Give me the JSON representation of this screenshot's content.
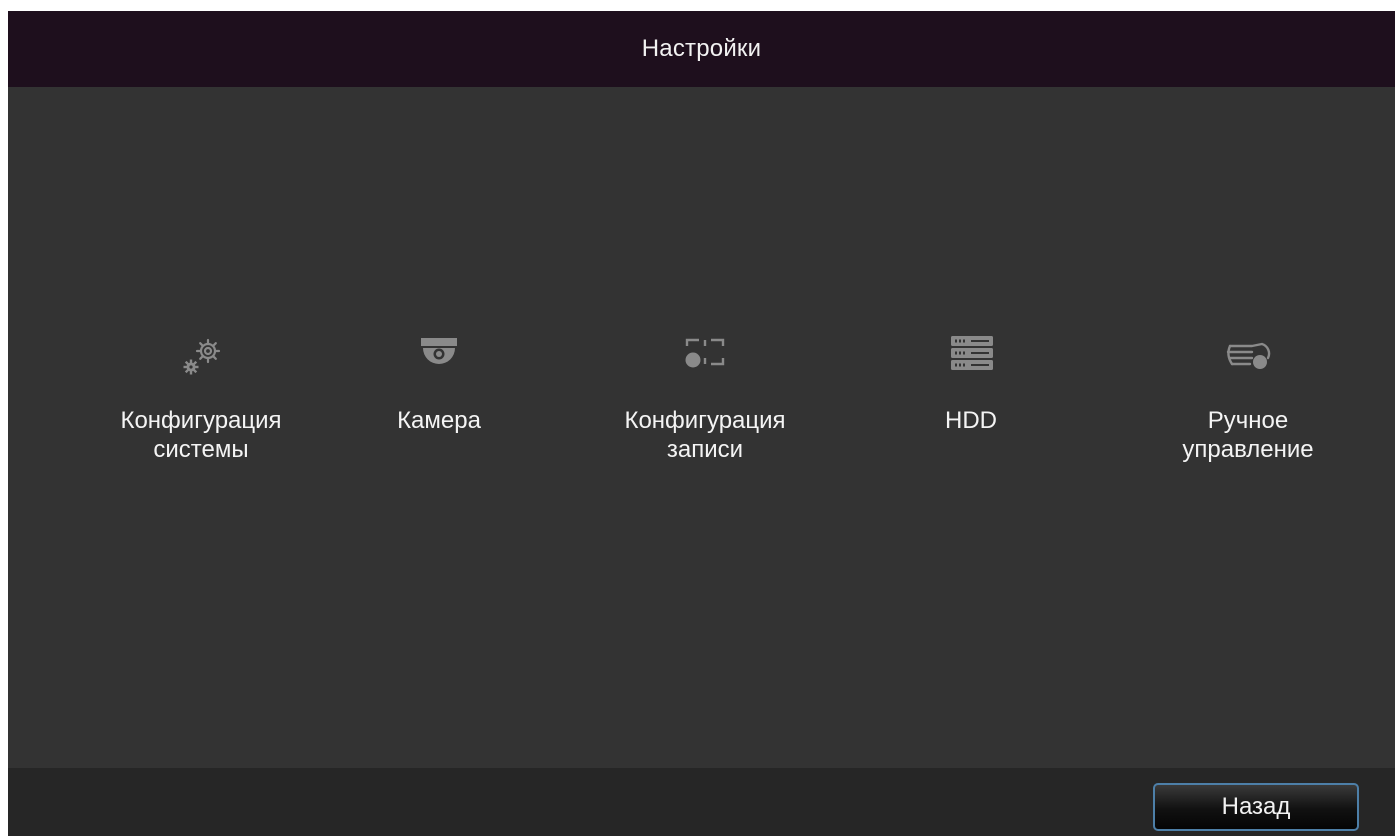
{
  "header": {
    "title": "Настройки"
  },
  "menu": {
    "items": [
      {
        "label": "Конфигурация\nсистемы",
        "icon": "gears-icon"
      },
      {
        "label": "Камера",
        "icon": "dome-camera-icon"
      },
      {
        "label": "Конфигурация\nзаписи",
        "icon": "record-config-icon"
      },
      {
        "label": "HDD",
        "icon": "hdd-rack-icon"
      },
      {
        "label": "Ручное\nуправление",
        "icon": "manual-control-icon"
      }
    ]
  },
  "footer": {
    "back_label": "Назад"
  },
  "colors": {
    "title_bar": "#1e0f1d",
    "background": "#333333",
    "footer": "#262626",
    "icon": "#8a8a8a",
    "button_border": "#4d7fa8"
  }
}
